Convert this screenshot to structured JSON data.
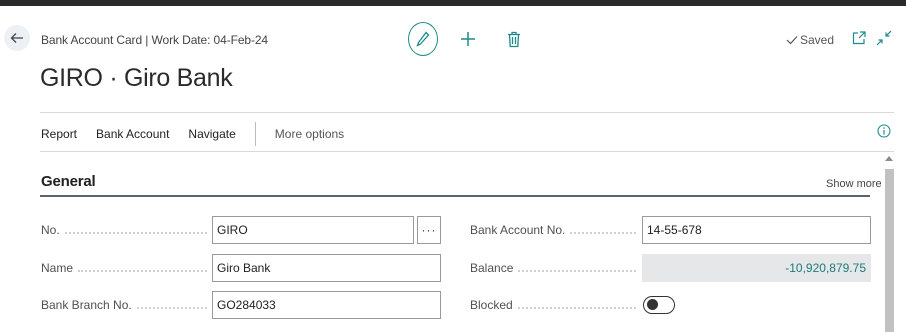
{
  "header": {
    "breadcrumb": "Bank Account Card | Work Date: 04-Feb-24",
    "title": "GIRO · Giro Bank",
    "status": "Saved",
    "icons": {
      "back": "arrow-left-icon",
      "edit": "pencil-icon",
      "new": "plus-icon",
      "delete": "trash-icon",
      "saved": "checkmark-icon",
      "open_new_window": "open-new-window-icon",
      "collapse": "collapse-arrows-icon"
    }
  },
  "action_bar": {
    "items": [
      "Report",
      "Bank Account",
      "Navigate"
    ],
    "more": "More options",
    "info_icon": "info-icon"
  },
  "section": {
    "title": "General",
    "show_more": "Show more"
  },
  "fields_left": [
    {
      "label": "No.",
      "value": "GIRO"
    },
    {
      "label": "Name",
      "value": "Giro Bank"
    },
    {
      "label": "Bank Branch No.",
      "value": "GO284033"
    }
  ],
  "fields_right": [
    {
      "label": "Bank Account No.",
      "value": "14-55-678"
    },
    {
      "label": "Balance",
      "value": "-10,920,879.75"
    },
    {
      "label": "Blocked",
      "value": false
    }
  ],
  "lookup_label": "···",
  "colors": {
    "accent": "#1f8a8a",
    "balance_text": "#1f7a7a",
    "readonly_bg": "#e5e7e8"
  }
}
